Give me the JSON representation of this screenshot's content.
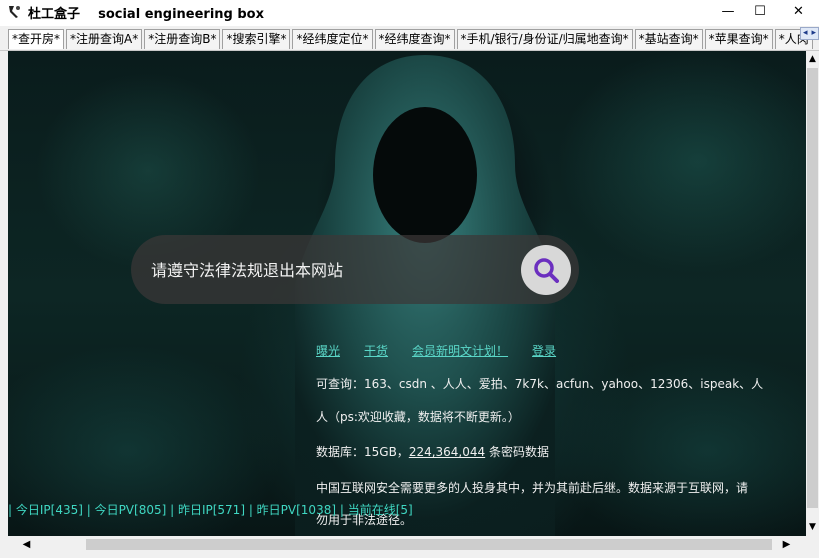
{
  "window": {
    "title": "杜工盒子    social engineering box",
    "minimize_icon": "—",
    "maximize_icon": "☐",
    "close_icon": "✕"
  },
  "tabs": [
    "*查开房*",
    "*注册查询A*",
    "*注册查询B*",
    "*搜索引擎*",
    "*经纬度定位*",
    "*经纬度查询*",
    "*手机/银行/身份证/归属地查询*",
    "*基站查询*",
    "*苹果查询*",
    "*人肉"
  ],
  "tab_scroll": {
    "left": "◂",
    "right": "▸"
  },
  "search": {
    "placeholder": "请遵守法律法规退出本网站",
    "icon": "search-icon"
  },
  "links": [
    "曝光",
    "干货",
    "会员新明文计划！",
    "登录"
  ],
  "info": {
    "line1": "可查询：163、csdn 、人人、爱拍、7k7k、acfun、yahoo、12306、ispeak、人",
    "line2": "人（ps:欢迎收藏，数据将不断更新。）",
    "db_prefix": "数据库：15GB，",
    "db_count": "224,364,044",
    "db_suffix": " 条密码数据",
    "line4": "中国互联网安全需要更多的人投身其中，并为其前赴后继。数据来源于互联网，请",
    "line5": "勿用于非法途径。"
  },
  "stats": "| 今日IP[435] | 今日PV[805] | 昨日IP[571] | 昨日PV[1038] | 当前在线[5]",
  "scroll": {
    "up": "▲",
    "down": "▼",
    "left": "◀",
    "right": "▶"
  },
  "colors": {
    "accent_link": "#5ad6c7",
    "stats_text": "#3fd7c2",
    "search_icon": "#6b2fbf"
  }
}
